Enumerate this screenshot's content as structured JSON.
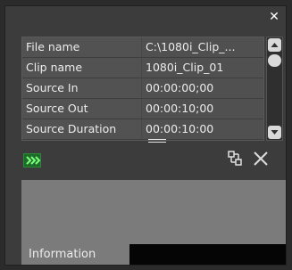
{
  "window": {
    "close_symbol": "✕"
  },
  "properties": [
    {
      "key": "File name",
      "value": "C:\\1080i_Clip_..."
    },
    {
      "key": "Clip name",
      "value": "1080i_Clip_01"
    },
    {
      "key": "Source In",
      "value": "00:00:00;00"
    },
    {
      "key": "Source Out",
      "value": "00:00:10;00"
    },
    {
      "key": "Source Duration",
      "value": "00:00:10:00"
    }
  ],
  "toolbar": {
    "status_icon": "play-forward-icon",
    "link_icon": "link-icon",
    "delete_icon": "close-x-icon"
  },
  "tabs": [
    {
      "label": "Information"
    }
  ],
  "colors": {
    "status_green": "#1e6a2a",
    "panel_bg": "#3c3c3c",
    "info_bg": "#7b7b7b"
  }
}
